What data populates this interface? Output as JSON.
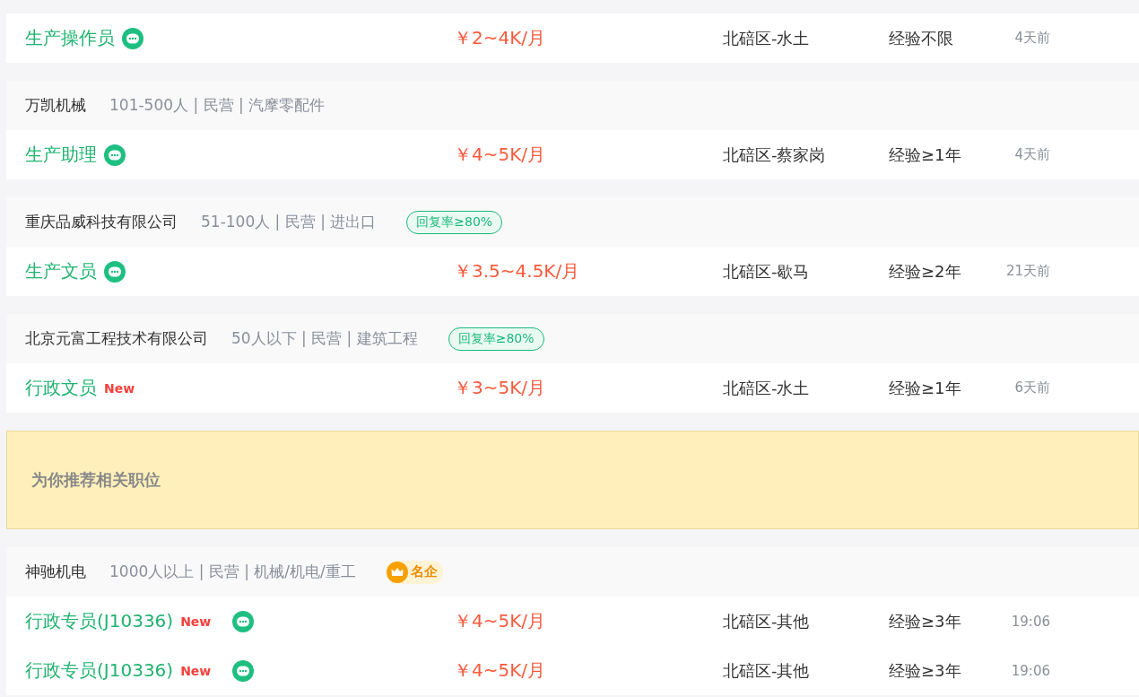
{
  "listings": [
    {
      "kind": "company",
      "jobs": [
        {
          "title": "生产操作员",
          "new": false,
          "chat": true,
          "salary": "￥2~4K/月",
          "location": "北碚区-水土",
          "experience": "经验不限",
          "posted": "4天前"
        }
      ]
    },
    {
      "kind": "company",
      "company": "万凯机械",
      "info": "101-500人 | 民营 | 汽摩零配件",
      "jobs": [
        {
          "title": "生产助理",
          "new": false,
          "chat": true,
          "salary": "￥4~5K/月",
          "location": "北碚区-蔡家岗",
          "experience": "经验≥1年",
          "posted": "4天前"
        }
      ]
    },
    {
      "kind": "company",
      "company": "重庆品威科技有限公司",
      "info": "51-100人 | 民营 | 进出口",
      "badge": {
        "kind": "reply-rate",
        "text": "回复率≥80%"
      },
      "jobs": [
        {
          "title": "生产文员",
          "new": false,
          "chat": true,
          "salary": "￥3.5~4.5K/月",
          "location": "北碚区-歇马",
          "experience": "经验≥2年",
          "posted": "21天前"
        }
      ]
    },
    {
      "kind": "company",
      "company": "北京元富工程技术有限公司",
      "info": "50人以下 | 民营 | 建筑工程",
      "badge": {
        "kind": "reply-rate",
        "text": "回复率≥80%"
      },
      "jobs": [
        {
          "title": "行政文员",
          "new": true,
          "new_label": "New",
          "chat": false,
          "salary": "￥3~5K/月",
          "location": "北碚区-水土",
          "experience": "经验≥1年",
          "posted": "6天前"
        }
      ]
    },
    {
      "kind": "banner",
      "text": "为你推荐相关职位"
    },
    {
      "kind": "company",
      "company": "神驰机电",
      "info": "1000人以上 | 民营 | 机械/机电/重工",
      "badge": {
        "kind": "famous",
        "text": "名企"
      },
      "jobs": [
        {
          "title": "行政专员(J10336)",
          "new": true,
          "new_label": "New",
          "chat": true,
          "salary": "￥4~5K/月",
          "location": "北碚区-其他",
          "experience": "经验≥3年",
          "posted": "19:06"
        },
        {
          "title": "行政专员(J10336)",
          "new": true,
          "new_label": "New",
          "chat": true,
          "salary": "￥4~5K/月",
          "location": "北碚区-其他",
          "experience": "经验≥3年",
          "posted": "19:06"
        }
      ]
    }
  ]
}
